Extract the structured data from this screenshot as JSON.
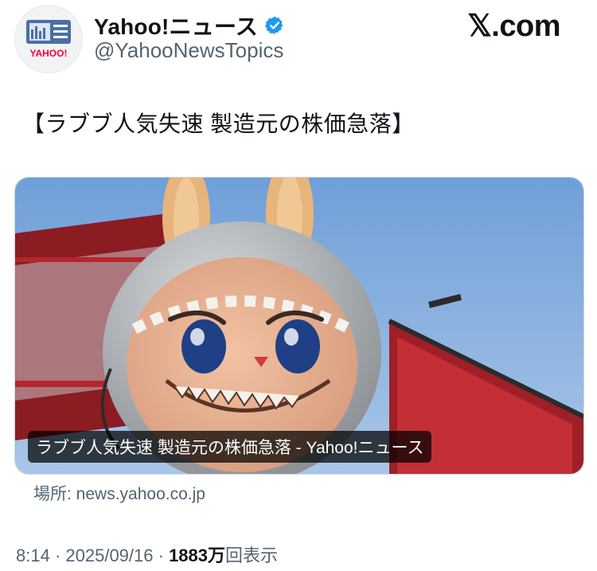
{
  "author": {
    "display_name": "Yahoo!ニュース",
    "handle": "@YahooNewsTopics",
    "avatar_logo_text": "YAHOO!",
    "verified_color": "#1d9bf0"
  },
  "brand": "𝕏.com",
  "tweet": {
    "text": "【ラブブ人気失速 製造元の株価急落】"
  },
  "card": {
    "caption": "ラブブ人気失速 製造元の株価急落 - Yahoo!ニュース",
    "source": "場所: news.yahoo.co.jp"
  },
  "meta": {
    "time": "8:14",
    "separator": " · ",
    "date": "2025/09/16",
    "views_number": "1883",
    "views_unit": "万",
    "views_label": "回表示"
  }
}
